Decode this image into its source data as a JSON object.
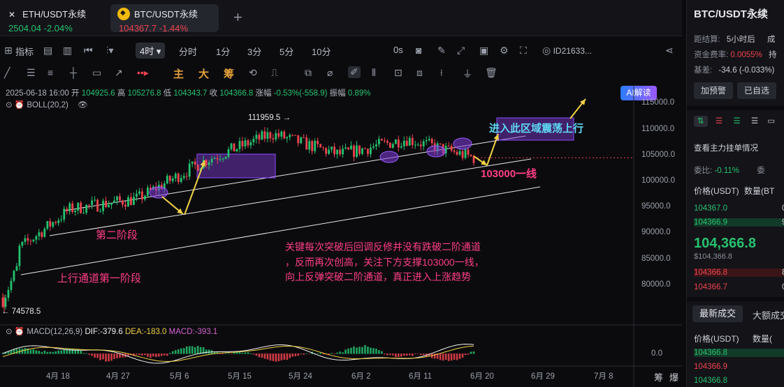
{
  "tabs": [
    {
      "title": "ETH/USDT永续",
      "price": "2504.04",
      "change": "-2.04%",
      "color": "#25c26e",
      "closable": true
    },
    {
      "title": "BTC/USDT永续",
      "price": "104367.7",
      "change": "-1.44%",
      "color": "#f0434e",
      "active": true
    }
  ],
  "toolbar": {
    "indicator": "指标",
    "timeframes": [
      "4时",
      "分时",
      "1分",
      "3分",
      "5分",
      "10分"
    ],
    "active_timeframe": "4时",
    "zero_s": "0s",
    "user_id": "ID21633...",
    "ai_button": "AI解读"
  },
  "draw_tools": {
    "main": "主",
    "big": "大",
    "chip": "筹"
  },
  "chart": {
    "ohlc": {
      "date": "2025-06-18 16:00",
      "open_label": "开",
      "open": "104925.6",
      "high_label": "高",
      "high": "105276.8",
      "low_label": "低",
      "low": "104343.7",
      "close_label": "收",
      "close": "104366.8",
      "change_label": "涨幅",
      "change": "-0.53%(-558.9)",
      "amp_label": "振幅",
      "amp": "0.89%"
    },
    "boll": "BOLL(20,2)",
    "macd": {
      "name": "MACD(12,26,9)",
      "dif": "DIF:-379.6",
      "dea": "DEA:-183.0",
      "macd": "MACD:-393.1"
    },
    "peak_label": "111959.5 →",
    "low_label": "← 74578.5",
    "y_ticks": [
      "115000.0",
      "110000.0",
      "105000.0",
      "100000.0",
      "95000.0",
      "90000.0",
      "85000.0",
      "80000.0"
    ],
    "macd_tick": "0.0",
    "x_ticks": [
      "4月 18",
      "4月 27",
      "5月 6",
      "5月 15",
      "5月 24",
      "6月 2",
      "6月 11",
      "6月 20",
      "6月 29",
      "7月 8"
    ],
    "corner": [
      "筹",
      "爆"
    ],
    "annotations": {
      "stage1": "上行通道第一阶段",
      "stage2": "第二阶段",
      "enter": "进入此区域震荡上行",
      "support": "103000一线",
      "note": [
        "关键每次突破后回调反修并没有跌破二阶通道",
        "，反而再次创高，关注下方支撑103000一线，",
        "向上反弹突破二阶通道，真正进入上涨趋势"
      ]
    }
  },
  "chart_data": {
    "type": "candlestick",
    "x": [
      "4月 18",
      "4月 27",
      "5月 6",
      "5月 15",
      "5月 24",
      "6月 2",
      "6月 11",
      "6月 20"
    ],
    "close_approx": [
      84500,
      94500,
      96500,
      103800,
      109000,
      105000,
      108000,
      104366.8
    ],
    "ylim": [
      74578.5,
      116000
    ],
    "high": 111959.5,
    "low": 74578.5
  },
  "side": {
    "title": "BTC/USDT永续",
    "settle_label": "距结算:",
    "settle_value": "5小时后",
    "settle_extra": "成",
    "funding_label": "资金费率:",
    "funding_value": "0.0055%",
    "funding_extra": "持",
    "basis_label": "基差:",
    "basis_value": "-34.6 (-0.033%)",
    "buttons": [
      "加预警",
      "已自选"
    ],
    "book_title": "查看主力挂单情况",
    "ratio_label": "委比:",
    "ratio_value": "-0.11%",
    "ratio_extra": "委",
    "col_price": "价格(USDT)",
    "col_qty": "数量(BT",
    "asks": [
      {
        "p": "104367.0",
        "q": "0"
      },
      {
        "p": "104366.9",
        "q": "9"
      }
    ],
    "last": "104,366.8",
    "last_sub": "$104,366.8",
    "bids": [
      {
        "p": "104366.8",
        "q": "8"
      },
      {
        "p": "104366.7",
        "q": "0"
      }
    ],
    "trades_tab": "最新成交",
    "big_tab": "大额成交",
    "trades_cols": [
      "价格(USDT)",
      "数量("
    ],
    "trades": [
      {
        "p": "104366.8",
        "c": "#25c26e"
      },
      {
        "p": "104366.9",
        "c": "#f0434e"
      },
      {
        "p": "104366.8",
        "c": "#25c26e"
      }
    ]
  }
}
